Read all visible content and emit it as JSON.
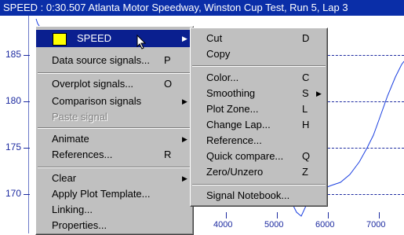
{
  "title": "SPEED : 0:30.507 Atlanta Motor Speedway, Winston Cup Test, Run 5, Lap 3",
  "colors": {
    "title_bg": "#0a2ea8",
    "trace": "#1a3fe0",
    "highlight": "#0a1f8f",
    "swatch": "#ffff00"
  },
  "axis": {
    "y_labels": [
      "185",
      "180",
      "175",
      "170"
    ],
    "x_labels": [
      "4000",
      "5000",
      "6000",
      "7000"
    ]
  },
  "main_menu": {
    "items": [
      {
        "label": "SPEED",
        "key": "",
        "submenu": true,
        "highlighted": true,
        "swatch": true
      },
      {
        "label": "Data source signals...",
        "key": "P"
      },
      {
        "label": "Overplot signals...",
        "key": "O"
      },
      {
        "label": "Comparison signals",
        "key": "",
        "submenu": true
      },
      {
        "label": "Paste signal",
        "key": "",
        "disabled": true
      },
      {
        "label": "Animate",
        "key": "",
        "submenu": true
      },
      {
        "label": "References...",
        "key": "R"
      },
      {
        "label": "Clear",
        "key": "",
        "submenu": true
      },
      {
        "label": "Apply Plot Template...",
        "key": ""
      },
      {
        "label": "Linking...",
        "key": ""
      },
      {
        "label": "Properties...",
        "key": ""
      }
    ]
  },
  "sub_menu": {
    "items": [
      {
        "label": "Cut",
        "key": "D"
      },
      {
        "label": "Copy",
        "key": ""
      },
      {
        "label": "Color...",
        "key": "C"
      },
      {
        "label": "Smoothing",
        "key": "S",
        "submenu": true
      },
      {
        "label": "Plot Zone...",
        "key": "L"
      },
      {
        "label": "Change Lap...",
        "key": "H"
      },
      {
        "label": "Reference...",
        "key": ""
      },
      {
        "label": "Quick compare...",
        "key": "Q"
      },
      {
        "label": "Zero/Unzero",
        "key": "Z"
      },
      {
        "label": "Signal Notebook...",
        "key": ""
      }
    ]
  }
}
